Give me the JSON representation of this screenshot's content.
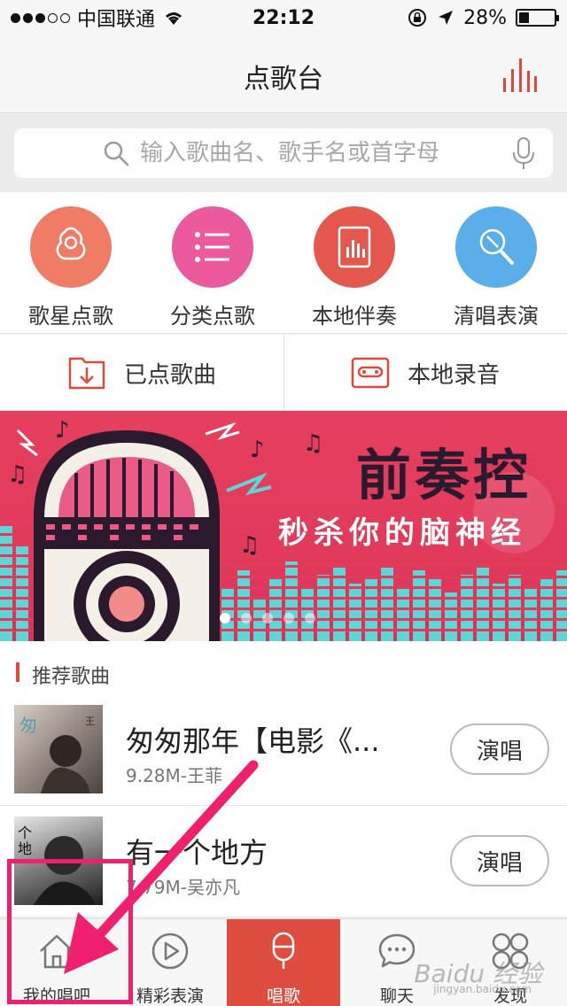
{
  "status_bar": {
    "carrier": "中国联通",
    "time": "22:12",
    "battery": "28%"
  },
  "nav": {
    "title": "点歌台"
  },
  "search": {
    "placeholder": "输入歌曲名、歌手名或首字母"
  },
  "features": [
    {
      "label": "歌星点歌",
      "color": "#f07c66",
      "icon": "singer-icon"
    },
    {
      "label": "分类点歌",
      "color": "#ea5a9d",
      "icon": "list-icon"
    },
    {
      "label": "本地伴奏",
      "color": "#e4584e",
      "icon": "audio-file-icon"
    },
    {
      "label": "清唱表演",
      "color": "#5aaeea",
      "icon": "microphone-icon"
    }
  ],
  "quick_links": [
    {
      "label": "已点歌曲",
      "icon": "download-box-icon"
    },
    {
      "label": "本地录音",
      "icon": "cassette-icon"
    }
  ],
  "banner": {
    "title": "前奏控",
    "subtitle": "秒杀你的脑神经"
  },
  "section": {
    "title": "推荐歌曲"
  },
  "songs": [
    {
      "title": "匆匆那年【电影《...",
      "meta": "9.28M-王菲",
      "action": "演唱"
    },
    {
      "title": "有一个地方",
      "meta": "7.79M-吴亦凡",
      "action": "演唱"
    }
  ],
  "tabs": [
    {
      "label": "我的唱吧",
      "icon": "home-icon",
      "active": false
    },
    {
      "label": "精彩表演",
      "icon": "play-icon",
      "active": false
    },
    {
      "label": "唱歌",
      "icon": "microphone-icon",
      "active": true
    },
    {
      "label": "聊天",
      "icon": "chat-icon",
      "active": false
    },
    {
      "label": "发现",
      "icon": "discover-icon",
      "active": false
    }
  ],
  "watermark": {
    "text": "Baidu 经验",
    "url": "jingyan.baidu.com"
  },
  "colors": {
    "accent": "#df4d3f",
    "annotation": "#f0206e"
  }
}
